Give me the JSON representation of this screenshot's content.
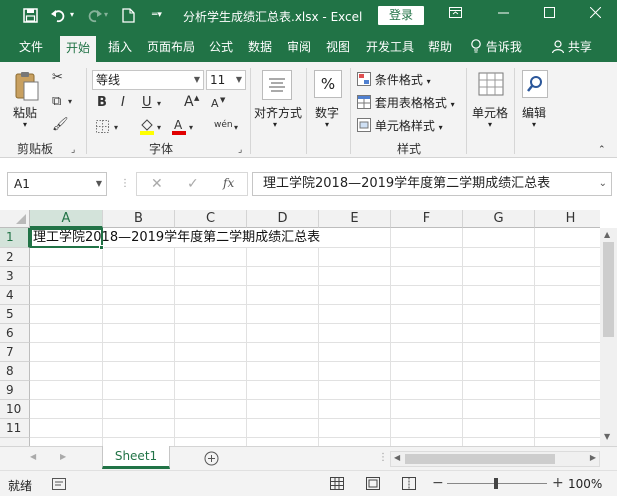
{
  "titlebar": {
    "doc_title": "分析学生成绩汇总表.xlsx  -  Excel",
    "login": "登录",
    "icons": [
      "save-icon",
      "undo-icon",
      "redo-icon",
      "new-file-icon",
      "customize-qat-icon",
      "ribbon-display-icon",
      "minimize-icon",
      "maximize-icon",
      "close-icon"
    ]
  },
  "tabs": [
    "文件",
    "开始",
    "插入",
    "页面布局",
    "公式",
    "数据",
    "审阅",
    "视图",
    "开发工具",
    "帮助"
  ],
  "active_tab": "开始",
  "tell_me": "告诉我",
  "share": "共享",
  "ribbon": {
    "clipboard": {
      "paste": "粘贴",
      "label": "剪贴板"
    },
    "font": {
      "name": "等线",
      "size": "11",
      "bold": "B",
      "italic": "I",
      "underline": "U",
      "grow": "A",
      "shrink": "A",
      "phonetic": "wén",
      "label": "字体"
    },
    "alignment": {
      "label": "对齐方式"
    },
    "number": {
      "label": "数字",
      "symbol": "%"
    },
    "styles": {
      "conditional": "条件格式",
      "table": "套用表格格式",
      "cell": "单元格样式",
      "label": "样式"
    },
    "cells": {
      "label": "单元格"
    },
    "editing": {
      "label": "编辑"
    }
  },
  "formula_bar": {
    "name_box": "A1",
    "fx": "fx",
    "content": "理工学院2018—2019学年度第二学期成绩汇总表"
  },
  "grid": {
    "columns": [
      "A",
      "B",
      "C",
      "D",
      "E",
      "F",
      "G",
      "H"
    ],
    "rows": [
      "1",
      "2",
      "3",
      "4",
      "5",
      "6",
      "7",
      "8",
      "9",
      "10",
      "11"
    ],
    "a1": "理工学院2018—2019学年度第二学期成绩汇总表"
  },
  "sheets": [
    "Sheet1"
  ],
  "status": {
    "mode": "就绪",
    "zoom": "100%"
  }
}
